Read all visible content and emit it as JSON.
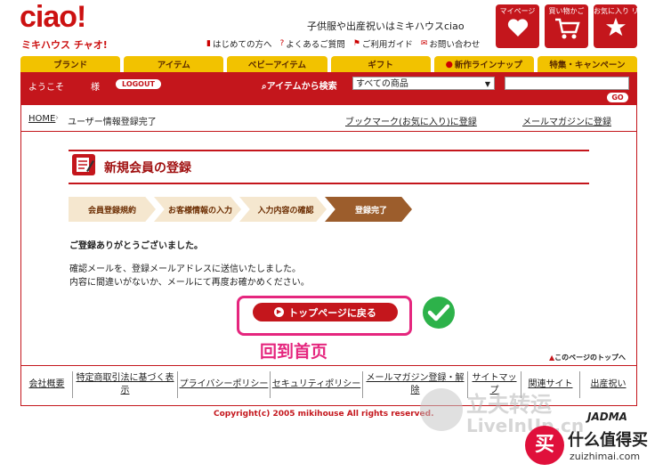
{
  "brand": {
    "logo": "ciao!",
    "logo_sub": "ミキハウス チャオ!",
    "tagline": "子供服や出産祝いはミキハウスciao"
  },
  "header_links": [
    {
      "icon": "book-icon",
      "label": "はじめての方へ"
    },
    {
      "icon": "question-icon",
      "label": "よくあるご質問"
    },
    {
      "icon": "flag-icon",
      "label": "ご利用ガイド"
    },
    {
      "icon": "mail-icon",
      "label": "お問い合わせ"
    }
  ],
  "header_buttons": {
    "mypage": "マイページ",
    "cart": "買い物かご",
    "favorites": "お気に入り リスト"
  },
  "tabs": [
    "ブランド",
    "アイテム",
    "ベビーアイテム",
    "ギフト",
    "新作ラインナップ",
    "特集・キャンペーン"
  ],
  "userbar": {
    "welcome": "ようこそ",
    "sama": "様",
    "logout": "LOGOUT",
    "search_label": "アイテムから検索",
    "category": "すべての商品",
    "go": "GO"
  },
  "breadcrumb": {
    "home": "HOME",
    "current": "ユーザー情報登録完了",
    "bookmark": "ブックマーク(お気に入り)に登録",
    "mailmag": "メールマガジンに登録"
  },
  "page": {
    "title": "新規会員の登録"
  },
  "steps": [
    "会員登録規約",
    "お客様情報の入力",
    "入力内容の確認",
    "登録完了"
  ],
  "message": {
    "thanks": "ご登録ありがとうございました。",
    "line1": "確認メールを、登録メールアドレスに送信いたしました。",
    "line2": "内容に間違いがないか、メールにて再度お確かめください。"
  },
  "top_button": "トップページに戻る",
  "annotation": "回到首页",
  "page_top": "このページのトップへ",
  "footer_links": [
    "会社概要",
    "特定商取引法に基づく表示",
    "プライバシーポリシー",
    "セキュリティポリシー",
    "メールマガジン登録・解除",
    "サイトマップ",
    "関連サイト",
    "出産祝い"
  ],
  "copyright": "Copyright(c) 2005 mikihouse All rights reserved.",
  "jdma": "JADMA",
  "watermarks": {
    "wm1_line1": "立夫转运",
    "wm1_line2": "LiveInUp.cn",
    "wm2_line1": "什么值得买",
    "wm2_line2": "zuizhimai.com",
    "wm2_icon": "买"
  },
  "colors": {
    "brand_red": "#c4161c",
    "tab_yellow": "#f2c200",
    "step_active": "#9c5d2c",
    "annotation_pink": "#e5267e"
  }
}
